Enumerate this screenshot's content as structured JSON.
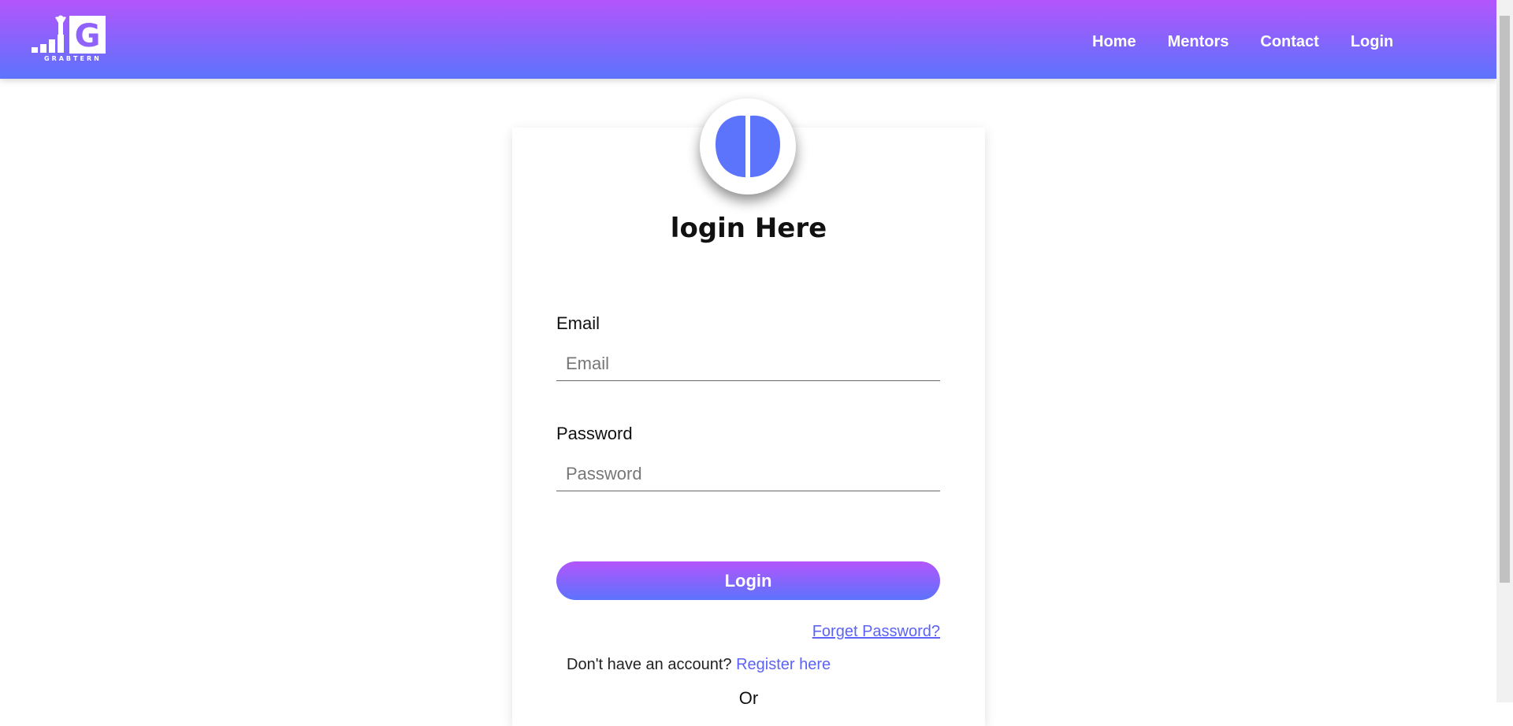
{
  "brand": {
    "logo_text": "GRABTERN",
    "logo_letter": "G"
  },
  "nav": {
    "items": [
      {
        "label": "Home"
      },
      {
        "label": "Mentors"
      },
      {
        "label": "Contact"
      },
      {
        "label": "Login"
      }
    ]
  },
  "form": {
    "title": "login Here",
    "email_label": "Email",
    "email_placeholder": "Email",
    "email_value": "",
    "password_label": "Password",
    "password_placeholder": "Password",
    "password_value": "",
    "submit_label": "Login",
    "forget_label": "Forget Password?",
    "register_prompt": "Don't have an account?",
    "register_link": "Register here",
    "or_text": "Or"
  },
  "colors": {
    "gradient_top": "#b355fc",
    "gradient_bottom": "#5c73fc",
    "link": "#5c63f5"
  }
}
